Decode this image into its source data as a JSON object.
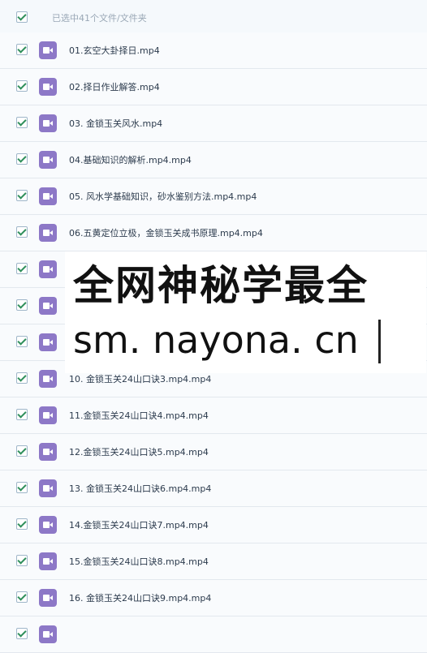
{
  "header": {
    "selection_text": "已选中41个文件/文件夹"
  },
  "files": [
    {
      "name": "01.玄空大卦择日.mp4"
    },
    {
      "name": "02.择日作业解答.mp4"
    },
    {
      "name": "03. 金锁玉关风水.mp4"
    },
    {
      "name": "04.基础知识的解析.mp4.mp4"
    },
    {
      "name": "05. 风水学基础知识，砂水鉴别方法.mp4.mp4"
    },
    {
      "name": "06.五黄定位立极，金锁玉关成书原理.mp4.mp4"
    },
    {
      "name": ""
    },
    {
      "name": ""
    },
    {
      "name": ""
    },
    {
      "name": "10. 金锁玉关24山口诀3.mp4.mp4"
    },
    {
      "name": "11.金锁玉关24山口诀4.mp4.mp4"
    },
    {
      "name": "12.金锁玉关24山口诀5.mp4.mp4"
    },
    {
      "name": "13. 金锁玉关24山口诀6.mp4.mp4"
    },
    {
      "name": "14.金锁玉关24山口诀7.mp4.mp4"
    },
    {
      "name": "15.金锁玉关24山口诀8.mp4.mp4"
    },
    {
      "name": "16. 金锁玉关24山口诀9.mp4.mp4"
    }
  ],
  "watermark": {
    "line1": "全网神秘学最全",
    "line2": "sm. nayona. cn"
  },
  "icons": {
    "file_icon": "video-file-icon",
    "checkbox": "checked-checkbox-icon"
  },
  "colors": {
    "icon_purple": "#8d78c7",
    "check_green": "#2f8f5b"
  }
}
